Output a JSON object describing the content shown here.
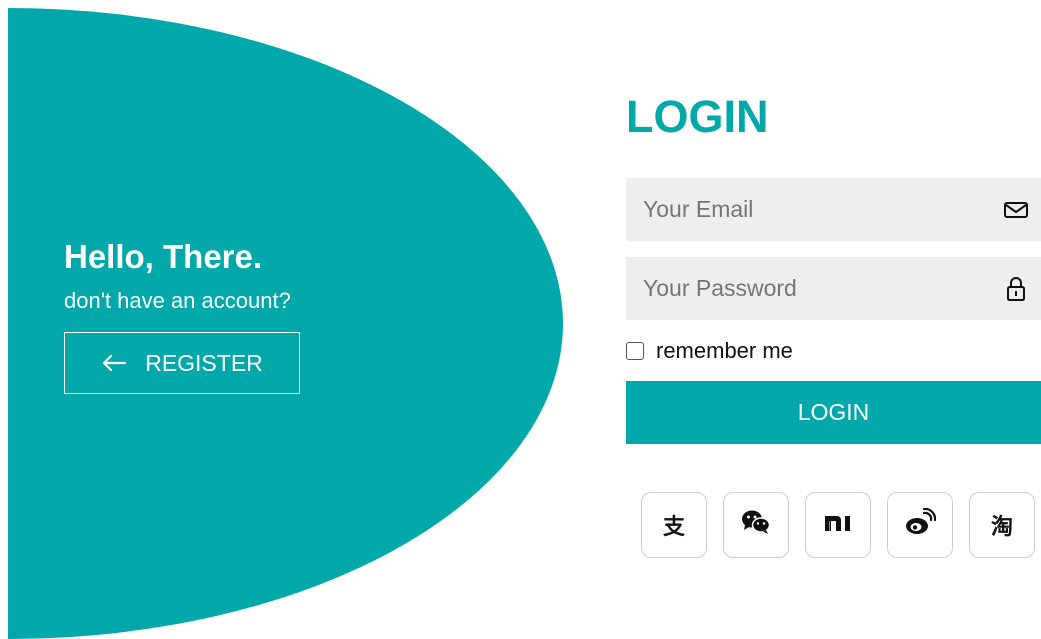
{
  "welcome": {
    "title": "Hello, There.",
    "subtitle": "don't have an account?",
    "register_label": "REGISTER"
  },
  "login": {
    "title": "LOGIN",
    "email_placeholder": "Your Email",
    "password_placeholder": "Your Password",
    "remember_label": "remember me",
    "remember_checked": false,
    "submit_label": "LOGIN"
  },
  "socials": [
    {
      "name": "alipay",
      "glyph": "支",
      "icon": "alipay-icon"
    },
    {
      "name": "wechat",
      "glyph": "",
      "icon": "wechat-icon"
    },
    {
      "name": "xiaomi",
      "glyph": "",
      "icon": "xiaomi-icon"
    },
    {
      "name": "weibo",
      "glyph": "",
      "icon": "weibo-icon"
    },
    {
      "name": "taobao",
      "glyph": "淘",
      "icon": "taobao-icon"
    }
  ],
  "colors": {
    "accent": "#00a8aa",
    "field_bg": "#eeeeee",
    "text": "#111111"
  }
}
